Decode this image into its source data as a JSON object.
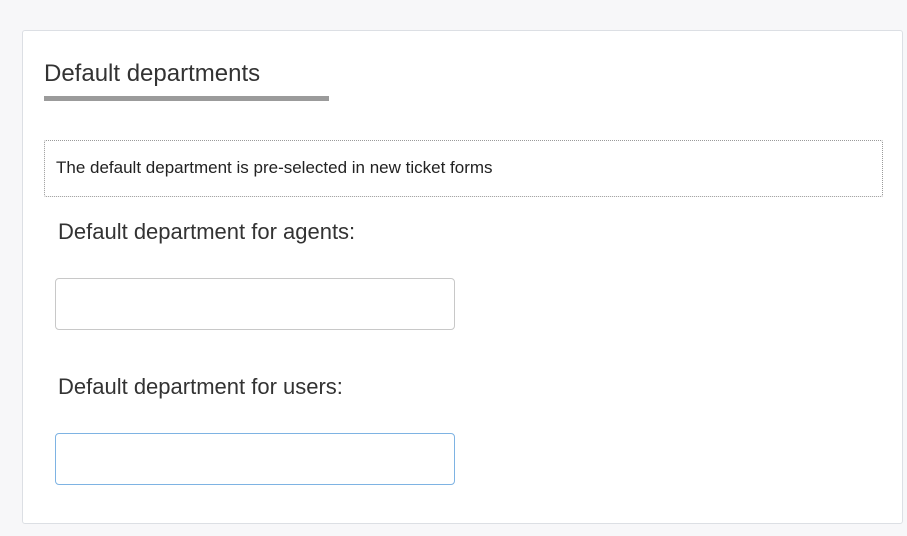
{
  "section": {
    "title": "Default departments",
    "hint": "The default department is pre-selected in new ticket forms"
  },
  "fields": {
    "agents": {
      "label": "Default department for agents:",
      "value": "",
      "placeholder": ""
    },
    "users": {
      "label": "Default department for users:",
      "value": "",
      "placeholder": ""
    }
  },
  "colors": {
    "focused_border": "#7eb3e3",
    "underline": "#9b9b9b"
  }
}
